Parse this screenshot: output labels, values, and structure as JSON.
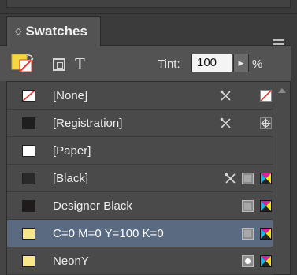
{
  "panel": {
    "tab_title": "Swatches",
    "tab_arrows": "◇"
  },
  "toolbar": {
    "text_button": "T",
    "tint_label": "Tint:",
    "tint_value": "100",
    "tint_arrow": "▶",
    "tint_unit": "%"
  },
  "swatches": [
    {
      "name": "[None]",
      "chip": "none",
      "non_editable": true,
      "type_icon": "none-icon"
    },
    {
      "name": "[Registration]",
      "chip": "#1e1e1e",
      "non_editable": true,
      "type_icon": "registration-icon"
    },
    {
      "name": "[Paper]",
      "chip": "#ffffff",
      "non_editable": false,
      "type_icon": ""
    },
    {
      "name": "[Black]",
      "chip": "#2a2a2a",
      "non_editable": true,
      "type_icon": "process-cmyk-icon"
    },
    {
      "name": "Designer Black",
      "chip": "#1f1b1b",
      "non_editable": false,
      "type_icon": "process-cmyk-icon"
    },
    {
      "name": "C=0 M=0 Y=100 K=0",
      "chip": "#f7e68a",
      "non_editable": false,
      "type_icon": "process-cmyk-icon",
      "selected": true
    },
    {
      "name": "NeonY",
      "chip": "#f7e68a",
      "non_editable": false,
      "type_icon": "spot-cmyk-icon"
    }
  ],
  "colors": {
    "panel_bg": "#535353",
    "selected_row": "#5a6a80",
    "fill_yellow": "#f5d742",
    "stroke_red": "#e03a2f",
    "cyan": "#1ab3e6",
    "magenta": "#d6249f",
    "yellow": "#f5e20a"
  }
}
